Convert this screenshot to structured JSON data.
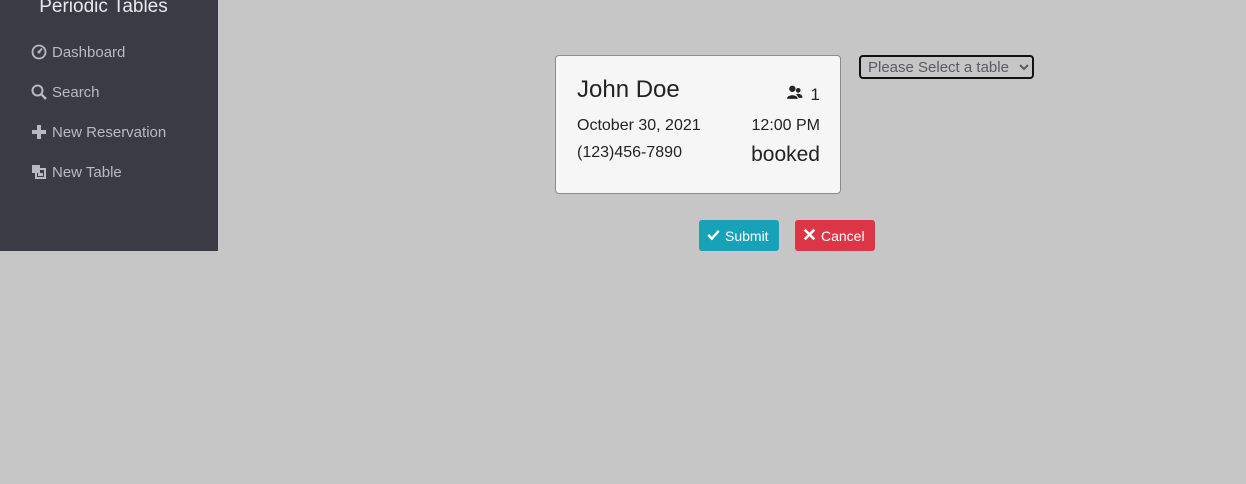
{
  "sidebar": {
    "brand": "Periodic Tables",
    "items": [
      {
        "label": "Dashboard",
        "icon": "dashboard-icon"
      },
      {
        "label": "Search",
        "icon": "search-icon"
      },
      {
        "label": "New Reservation",
        "icon": "plus-icon"
      },
      {
        "label": "New Table",
        "icon": "layers-icon"
      }
    ]
  },
  "reservation": {
    "name": "John Doe",
    "people": "1",
    "date": "October 30, 2021",
    "time": "12:00 PM",
    "phone": "(123)456-7890",
    "status": "booked"
  },
  "table_select": {
    "selected": "Please Select a table",
    "options": [
      "Please Select a table"
    ]
  },
  "actions": {
    "submit_label": "Submit",
    "cancel_label": "Cancel"
  },
  "colors": {
    "background": "#c6c6c6",
    "sidebar": "#3b3b45",
    "submit": "#17a2b8",
    "cancel": "#dc3545"
  }
}
